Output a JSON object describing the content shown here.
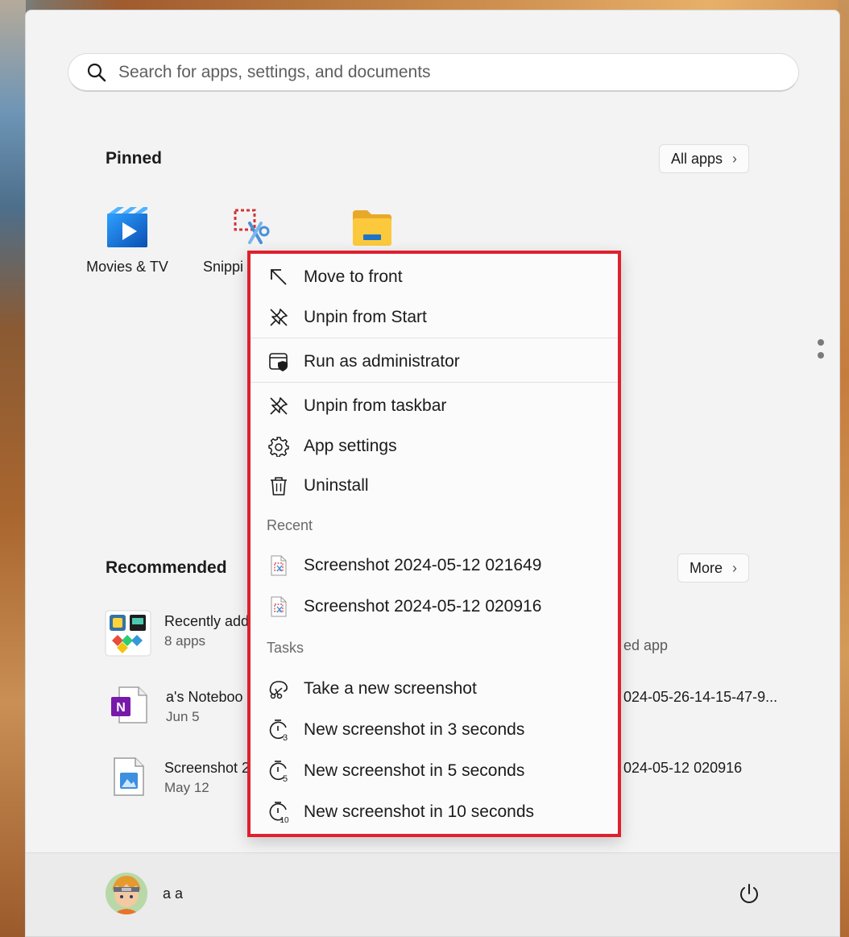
{
  "search": {
    "placeholder": "Search for apps, settings, and documents"
  },
  "pinned": {
    "title": "Pinned",
    "all_apps_label": "All apps",
    "apps": [
      {
        "label": "Movies & TV",
        "icon": "movies-tv-icon"
      },
      {
        "label": "Snippi",
        "icon": "snipping-tool-icon"
      },
      {
        "label": "",
        "icon": "file-explorer-icon"
      }
    ]
  },
  "recommended": {
    "title": "Recommended",
    "more_label": "More",
    "items": [
      {
        "name": "Recently add",
        "sub": "8 apps",
        "right": "ed app",
        "icon": "recently-added-icon"
      },
      {
        "name": "a's Noteboo",
        "sub": "Jun 5",
        "right": "024-05-26-14-15-47-9...",
        "icon": "onenote-icon"
      },
      {
        "name": "Screenshot 2",
        "sub": "May 12",
        "right": "024-05-12 020916",
        "icon": "image-file-icon"
      }
    ]
  },
  "user": {
    "name": "a a"
  },
  "context_menu": {
    "items_top": [
      {
        "label": "Move to front",
        "icon": "move-to-front-icon"
      },
      {
        "label": "Unpin from Start",
        "icon": "unpin-icon"
      }
    ],
    "items_admin": [
      {
        "label": "Run as administrator",
        "icon": "admin-shield-icon"
      }
    ],
    "items_main": [
      {
        "label": "Unpin from taskbar",
        "icon": "unpin-icon"
      },
      {
        "label": "App settings",
        "icon": "gear-icon"
      },
      {
        "label": "Uninstall",
        "icon": "trash-icon"
      }
    ],
    "recent_header": "Recent",
    "recent": [
      {
        "label": "Screenshot 2024-05-12 021649",
        "icon": "image-file-icon"
      },
      {
        "label": "Screenshot 2024-05-12 020916",
        "icon": "image-file-icon"
      }
    ],
    "tasks_header": "Tasks",
    "tasks": [
      {
        "label": "Take a new screenshot",
        "icon": "snip-icon"
      },
      {
        "label": "New screenshot in 3 seconds",
        "icon": "timer-3-icon"
      },
      {
        "label": "New screenshot in 5 seconds",
        "icon": "timer-5-icon"
      },
      {
        "label": "New screenshot in 10 seconds",
        "icon": "timer-10-icon"
      }
    ]
  },
  "colors": {
    "highlight_border": "#e0202d",
    "accent": "#0078d4"
  }
}
